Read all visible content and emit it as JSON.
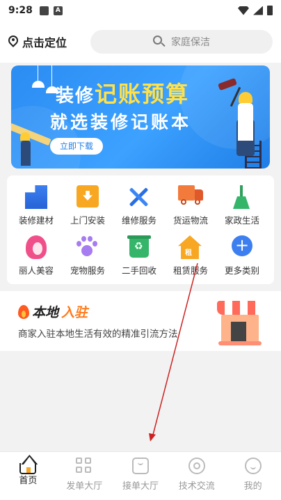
{
  "status_bar": {
    "time": "9:28",
    "notif_letter": "A"
  },
  "header": {
    "location_label": "点击定位",
    "search_placeholder": "家庭保洁"
  },
  "banner": {
    "line1_prefix": "装修",
    "line1_highlight": "记账预算",
    "line2": "就选装修记账本",
    "button": "立即下载"
  },
  "categories": [
    {
      "label": "装修建材",
      "icon": "building-icon"
    },
    {
      "label": "上门安装",
      "icon": "install-box-icon"
    },
    {
      "label": "维修服务",
      "icon": "tools-icon"
    },
    {
      "label": "货运物流",
      "icon": "truck-icon"
    },
    {
      "label": "家政生活",
      "icon": "broom-icon"
    },
    {
      "label": "丽人美容",
      "icon": "beauty-face-icon"
    },
    {
      "label": "宠物服务",
      "icon": "paw-icon"
    },
    {
      "label": "二手回收",
      "icon": "recycle-bin-icon"
    },
    {
      "label": "租赁服务",
      "icon": "rent-house-icon"
    },
    {
      "label": "更多类别",
      "icon": "plus-icon"
    }
  ],
  "local": {
    "title_black": "本地",
    "title_orange": "入驻",
    "desc": "商家入驻本地生活有效的精准引流方法"
  },
  "bottom_nav": [
    {
      "label": "首页",
      "icon": "home-icon",
      "active": true
    },
    {
      "label": "发单大厅",
      "icon": "grid-icon",
      "active": false
    },
    {
      "label": "接单大厅",
      "icon": "bag-icon",
      "active": false
    },
    {
      "label": "技术交流",
      "icon": "ring-icon",
      "active": false
    },
    {
      "label": "我的",
      "icon": "profile-icon",
      "active": false
    }
  ],
  "colors": {
    "accent_blue": "#2b8cf2",
    "highlight_yellow": "#ffe14a",
    "local_orange": "#ff7a1a",
    "annotation_arrow": "#cc2222"
  }
}
